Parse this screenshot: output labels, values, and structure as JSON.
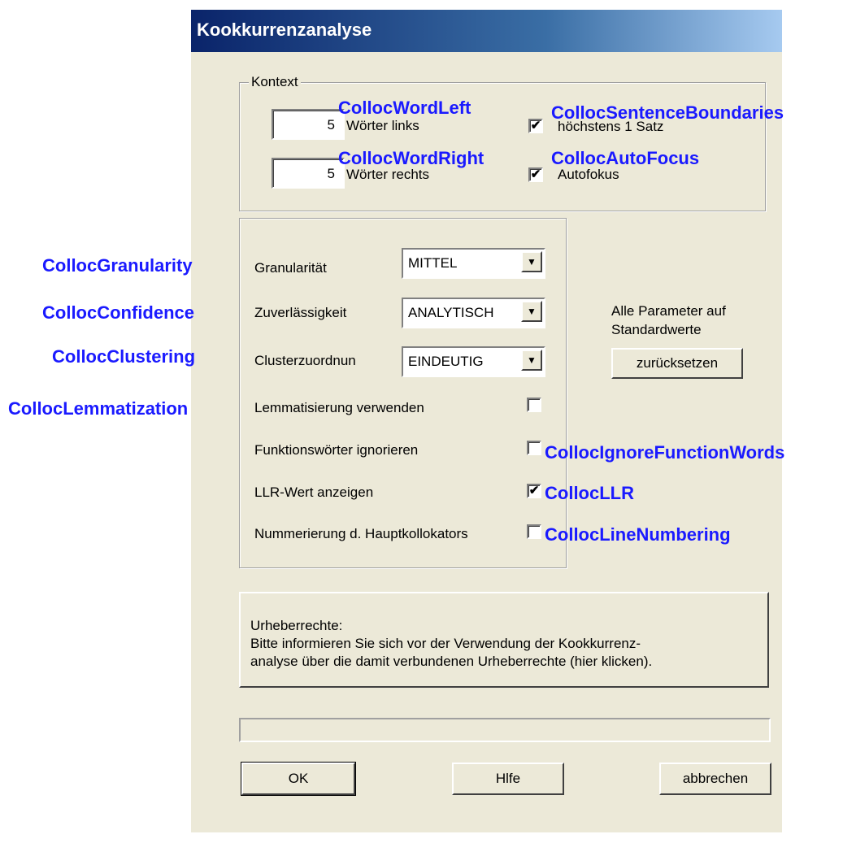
{
  "window": {
    "title": "Kookkurrenzanalyse"
  },
  "context": {
    "group_label": "Kontext",
    "words_left": {
      "value": "5",
      "label": "Wörter links",
      "annotation": "CollocWordLeft"
    },
    "words_right": {
      "value": "5",
      "label": "Wörter rechts",
      "annotation": "CollocWordRight"
    },
    "max_sentence": {
      "checked": true,
      "label": "höchstens 1 Satz",
      "annotation": "CollocSentenceBoundaries"
    },
    "autofocus": {
      "checked": true,
      "label": "Autofokus",
      "annotation": "CollocAutoFocus"
    }
  },
  "params": {
    "granularity": {
      "label": "Granularität",
      "value": "MITTEL",
      "annotation": "CollocGranularity"
    },
    "confidence": {
      "label": "Zuverlässigkeit",
      "value": "ANALYTISCH",
      "annotation": "CollocConfidence"
    },
    "clustering": {
      "label": "Clusterzuordnun",
      "value": "EINDEUTIG",
      "annotation": "CollocClustering"
    },
    "lemmatization": {
      "label": "Lemmatisierung verwenden",
      "checked": false,
      "annotation": "CollocLemmatization"
    },
    "function_words": {
      "label": "Funktionswörter ignorieren",
      "checked": false,
      "annotation": "CollocIgnoreFunctionWords"
    },
    "llr": {
      "label": "LLR-Wert anzeigen",
      "checked": true,
      "annotation": "CollocLLR"
    },
    "numbering": {
      "label": "Nummerierung d. Hauptkollokators",
      "checked": false,
      "annotation": "CollocLineNumbering"
    }
  },
  "reset": {
    "line1": "Alle Parameter auf",
    "line2": "Standardwerte",
    "button": "zurücksetzen"
  },
  "copyright": {
    "line1": "Urheberrechte:",
    "line2": "Bitte informieren Sie sich vor der Verwendung der Kookkurrenz-",
    "line3": "analyse über die damit verbundenen Urheberrechte (hier klicken)."
  },
  "buttons": {
    "ok": "OK",
    "help": "Hlfe",
    "cancel": "abbrechen"
  }
}
